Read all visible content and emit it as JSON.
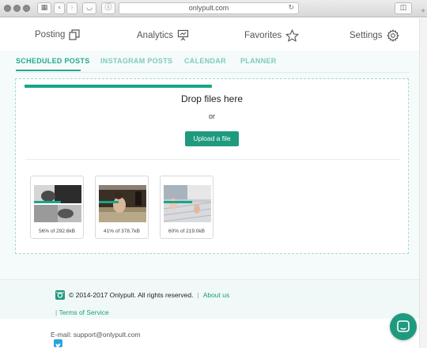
{
  "browser": {
    "url": "onlypult.com",
    "icons": [
      "sidebar-toggle-icon",
      "back-icon",
      "forward-icon",
      "pocket-icon",
      "info-icon",
      "reload-icon",
      "add-tab-icon"
    ]
  },
  "nav": {
    "items": [
      {
        "label": "Posting",
        "icon": "copy-icon"
      },
      {
        "label": "Analytics",
        "icon": "presentation-icon"
      },
      {
        "label": "Favorites",
        "icon": "star-icon"
      },
      {
        "label": "Settings",
        "icon": "gear-icon"
      }
    ]
  },
  "tabs": [
    {
      "label": "SCHEDULED POSTS",
      "active": true
    },
    {
      "label": "INSTAGRAM POSTS",
      "active": false
    },
    {
      "label": "CALENDAR",
      "active": false
    },
    {
      "label": "PLANNER",
      "active": false
    }
  ],
  "dropzone": {
    "title": "Drop files here",
    "or": "or",
    "upload_label": "Upload a file",
    "overall_progress": 0.5
  },
  "uploads": [
    {
      "label": "56% of 292.6kB",
      "progress": 0.56
    },
    {
      "label": "41% of 378.7kB",
      "progress": 0.41
    },
    {
      "label": "60% of 219.0kB",
      "progress": 0.6
    }
  ],
  "footer": {
    "copyright": "© 2014-2017 Onlypult. All rights reserved.",
    "about": "About us",
    "tos": "Terms of Service",
    "email": "E-mail: support@onlypult.com",
    "separator": "|"
  },
  "colors": {
    "accent": "#1f9a7f",
    "tab_inactive": "#7fcbbd",
    "twitter": "#2aa3de"
  }
}
